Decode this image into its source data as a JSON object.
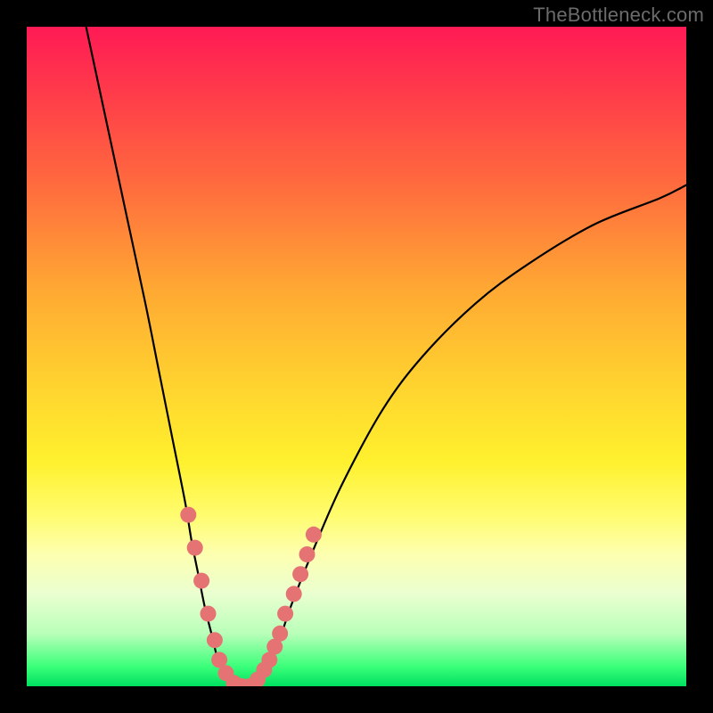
{
  "attribution": "TheBottleneck.com",
  "chart_data": {
    "type": "line",
    "title": "",
    "xlabel": "",
    "ylabel": "",
    "xlim": [
      0,
      100
    ],
    "ylim": [
      0,
      100
    ],
    "grid": false,
    "legend": false,
    "series": [
      {
        "name": "bottleneck-curve",
        "color": "#000000",
        "x": [
          9,
          12,
          15,
          18,
          20,
          22,
          24,
          25,
          26,
          27,
          28,
          29,
          30,
          31,
          32,
          33,
          34,
          36,
          38,
          40,
          44,
          48,
          54,
          60,
          68,
          76,
          86,
          96,
          100
        ],
        "y": [
          100,
          86,
          72,
          58,
          48,
          38,
          28,
          22,
          17,
          12,
          8,
          4,
          2,
          0.5,
          0,
          0,
          0.5,
          2,
          6,
          12,
          22,
          31,
          42,
          50,
          58,
          64,
          70,
          74,
          76
        ]
      }
    ],
    "markers": {
      "name": "highlighted-points",
      "color": "#e57373",
      "radius_px": 9,
      "x": [
        24.5,
        25.5,
        26.5,
        27.5,
        28.5,
        29.2,
        30.2,
        31.4,
        32.6,
        33.8,
        35.0,
        36.0,
        36.8,
        37.6,
        38.4,
        39.2,
        40.5,
        41.5,
        42.5,
        43.5
      ],
      "y": [
        26,
        21,
        16,
        11,
        7,
        4,
        2,
        0.5,
        0,
        0,
        1,
        2.5,
        4,
        6,
        8,
        11,
        14,
        17,
        20,
        23
      ]
    },
    "background_gradient_stops": [
      {
        "pos": 0.0,
        "color": "#ff1a55"
      },
      {
        "pos": 0.1,
        "color": "#ff3b4a"
      },
      {
        "pos": 0.24,
        "color": "#ff6b3e"
      },
      {
        "pos": 0.4,
        "color": "#ffa933"
      },
      {
        "pos": 0.54,
        "color": "#ffd22f"
      },
      {
        "pos": 0.66,
        "color": "#fff12e"
      },
      {
        "pos": 0.74,
        "color": "#fffc6e"
      },
      {
        "pos": 0.8,
        "color": "#fdffb0"
      },
      {
        "pos": 0.86,
        "color": "#eaffd0"
      },
      {
        "pos": 0.92,
        "color": "#b9ffb9"
      },
      {
        "pos": 0.97,
        "color": "#3bff7a"
      },
      {
        "pos": 1.0,
        "color": "#00e060"
      }
    ]
  }
}
